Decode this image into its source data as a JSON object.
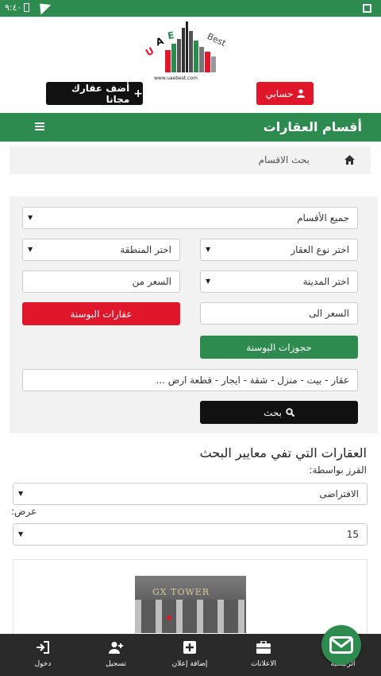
{
  "status_bar": {
    "time": "٩:٤٠"
  },
  "header": {
    "logo_letters": "U A E",
    "logo_best": "Best",
    "logo_url": "www.uaebest.com",
    "add_property_label": "أضف عقارك مجانا",
    "account_label": "حسابي"
  },
  "section": {
    "title": "أقسام العقارات"
  },
  "breadcrumb": {
    "text": "بحث الاقسام"
  },
  "search": {
    "all_sections": "جميع الأقسام",
    "property_type": "اختر نوع العقار",
    "area": "اختر المنطقة",
    "city": "اختر المدينة",
    "price_from": "السعر من",
    "price_to": "السعر الى",
    "bosna_properties": "عقارات البوسنة",
    "bosna_bookings": "حجوزات البوسنة",
    "keyword_placeholder": "عقار - بيت - منزل - شقة - ايجار - قطعة ارض ...",
    "search_button": "بحث"
  },
  "results": {
    "title": "العقارات التي تفي معايير البحث",
    "sort_label": "الفرز بواسطة:",
    "sort_value": "الافتراضى",
    "view_label": "عرض:",
    "view_value": "15",
    "card_image_sign": "GX TOWER"
  },
  "bottom_nav": {
    "items": [
      {
        "label": "دخول",
        "icon": "login-icon"
      },
      {
        "label": "تسجيل",
        "icon": "user-plus-icon"
      },
      {
        "label": "إضافة إعلان",
        "icon": "plus-square-icon"
      },
      {
        "label": "الاعلانات",
        "icon": "briefcase-icon"
      },
      {
        "label": "الرئيسية",
        "icon": "home-icon"
      }
    ]
  },
  "colors": {
    "green": "#2e8b4f",
    "red": "#e0162b",
    "black": "#111111"
  }
}
